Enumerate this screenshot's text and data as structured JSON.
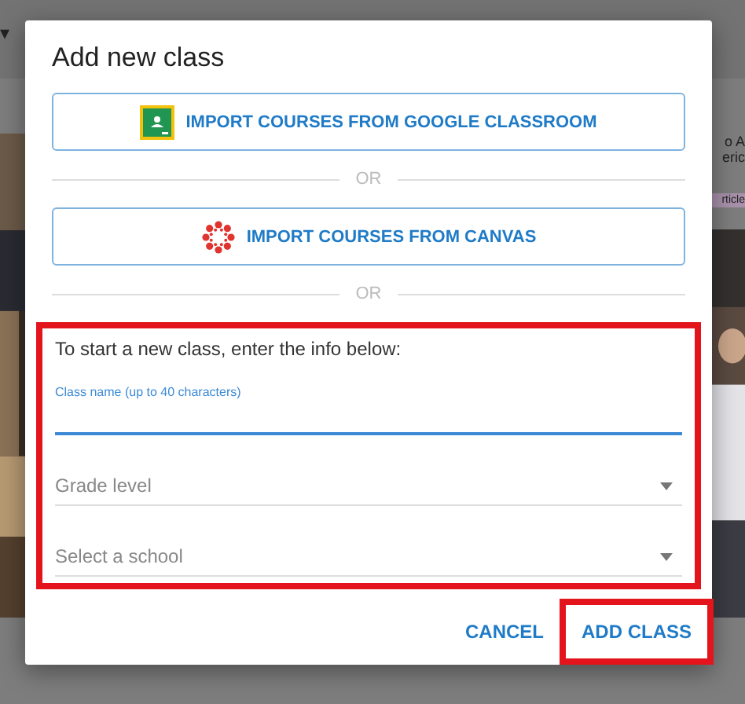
{
  "background": {
    "header_caret": "▾",
    "fragments": [
      "o A",
      "eric"
    ],
    "tag": "rticle"
  },
  "dialog": {
    "title": "Add new class",
    "imports": [
      {
        "kind": "google",
        "label": "IMPORT COURSES FROM GOOGLE CLASSROOM",
        "separator": "OR"
      },
      {
        "kind": "canvas",
        "label": "IMPORT COURSES FROM CANVAS",
        "separator": "OR"
      }
    ],
    "highlighted_form": true,
    "intro": "To start a new class, enter the info below:",
    "fields": [
      {
        "kind": "text",
        "label": "Class name (up to 40 characters)",
        "focused": true
      },
      {
        "kind": "select",
        "placeholder": "Grade level"
      },
      {
        "kind": "select",
        "placeholder": "Select a school"
      }
    ],
    "actions": [
      {
        "label": "CANCEL",
        "highlighted": false
      },
      {
        "label": "ADD CLASS",
        "highlighted": true
      }
    ]
  }
}
